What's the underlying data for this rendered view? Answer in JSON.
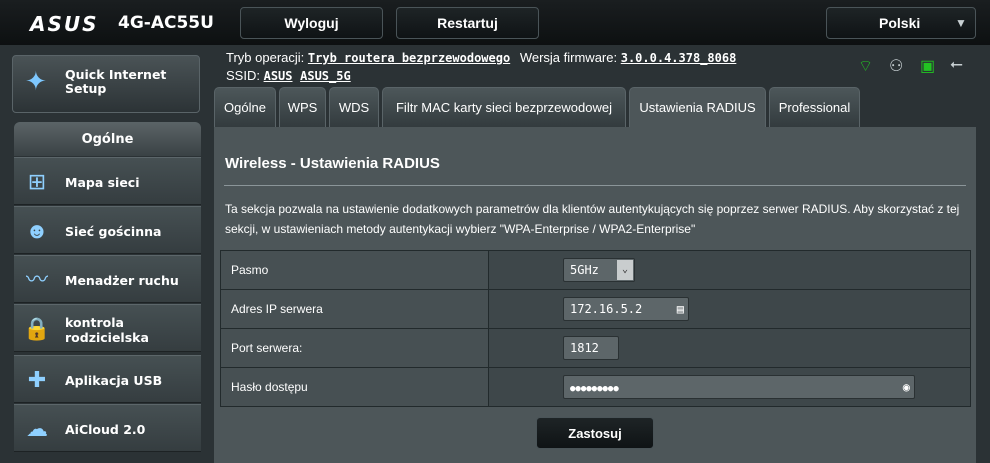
{
  "header": {
    "brand": "ASUS",
    "model": "4G-AC55U",
    "logout_label": "Wyloguj",
    "restart_label": "Restartuj",
    "language": "Polski"
  },
  "sidebar": {
    "quick_setup_line1": "Quick Internet",
    "quick_setup_line2": "Setup",
    "section_title": "Ogólne",
    "items": [
      {
        "label_1": "Mapa sieci",
        "label_2": ""
      },
      {
        "label_1": "Sieć gościnna",
        "label_2": ""
      },
      {
        "label_1": "Menadżer ruchu",
        "label_2": ""
      },
      {
        "label_1": "kontrola",
        "label_2": "rodzicielska"
      },
      {
        "label_1": "Aplikacja USB",
        "label_2": ""
      },
      {
        "label_1": "AiCloud 2.0",
        "label_2": ""
      }
    ]
  },
  "info": {
    "mode_label": "Tryb operacji:",
    "mode_value": "Tryb routera bezprzewodowego",
    "fw_label": "Wersja firmware:",
    "fw_value": "3.0.0.4.378_8068",
    "ssid_label": "SSID:",
    "ssid_1": "ASUS",
    "ssid_2": "ASUS_5G"
  },
  "tabs": [
    "Ogólne",
    "WPS",
    "WDS",
    "Filtr MAC karty sieci bezprzewodowej",
    "Ustawienia RADIUS",
    "Professional"
  ],
  "active_tab": "Ustawienia RADIUS",
  "page": {
    "title": "Wireless - Ustawienia RADIUS",
    "description": "Ta sekcja pozwala na ustawienie dodatkowych parametrów dla klientów autentykujących się poprzez serwer RADIUS. Aby skorzystać z tej sekcji, w ustawieniach metody autentykacji wybierz \"WPA-Enterprise / WPA2-Enterprise\"",
    "fields": {
      "band_label": "Pasmo",
      "band_value": "5GHz",
      "server_ip_label": "Adres IP serwera",
      "server_ip_value": "172.16.5.2",
      "server_port_label": "Port serwera:",
      "server_port_value": "1812",
      "password_label": "Hasło dostępu",
      "password_value": "●●●●●●●●●"
    },
    "apply_label": "Zastosuj"
  },
  "colors": {
    "accent": "#8fd0ff",
    "status_green": "#22c422",
    "panel": "#4d5659"
  }
}
